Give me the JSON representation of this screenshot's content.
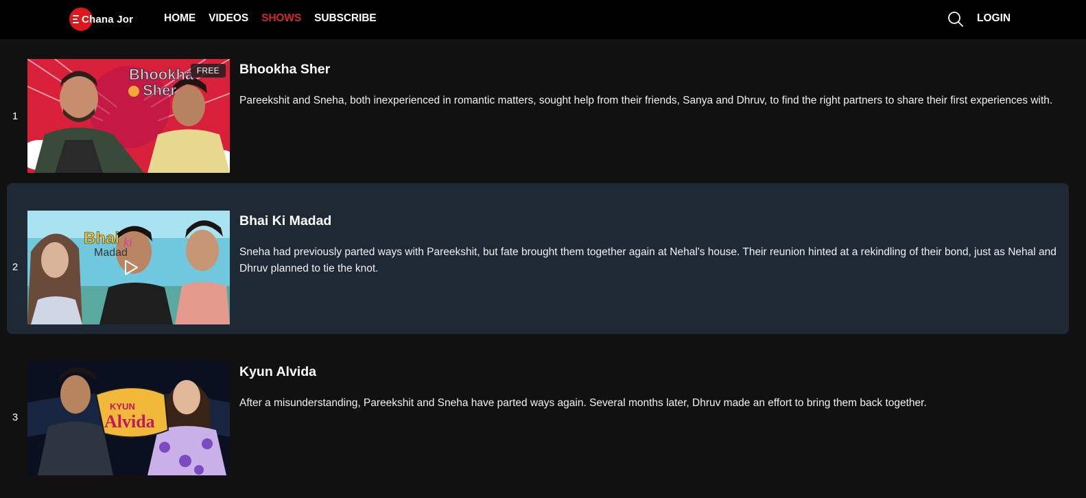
{
  "header": {
    "logo_text": "Chana Jor",
    "brand_color": "#e0161d",
    "nav": [
      {
        "label": "HOME",
        "active": false
      },
      {
        "label": "VIDEOS",
        "active": false
      },
      {
        "label": "SHOWS",
        "active": true
      },
      {
        "label": "SUBSCRIBE",
        "active": false
      }
    ],
    "search_icon": "search-icon",
    "login_label": "LOGIN"
  },
  "episodes": [
    {
      "number": "1",
      "title": "Bhookha Sher",
      "badge": "FREE",
      "thumbnail_text": [
        "Bhookha",
        "Sher"
      ],
      "description": "Pareekshit and Sneha, both inexperienced in romantic matters, sought help from their friends, Sanya and Dhruv, to find the right partners to share their first experiences with."
    },
    {
      "number": "2",
      "title": "Bhai Ki Madad",
      "thumbnail_text": [
        "Bhai",
        "ki",
        "Madad"
      ],
      "description": "Sneha had previously parted ways with Pareekshit, but fate brought them together again at Nehal's house. Their reunion hinted at a rekindling of their bond, just as Nehal and Dhruv planned to tie the knot."
    },
    {
      "number": "3",
      "title": "Kyun Alvida",
      "thumbnail_text": [
        "KYUN",
        "Alvida"
      ],
      "description": "After a misunderstanding, Pareekshit and Sneha have parted ways again. Several months later, Dhruv made an effort to bring them back together."
    }
  ]
}
